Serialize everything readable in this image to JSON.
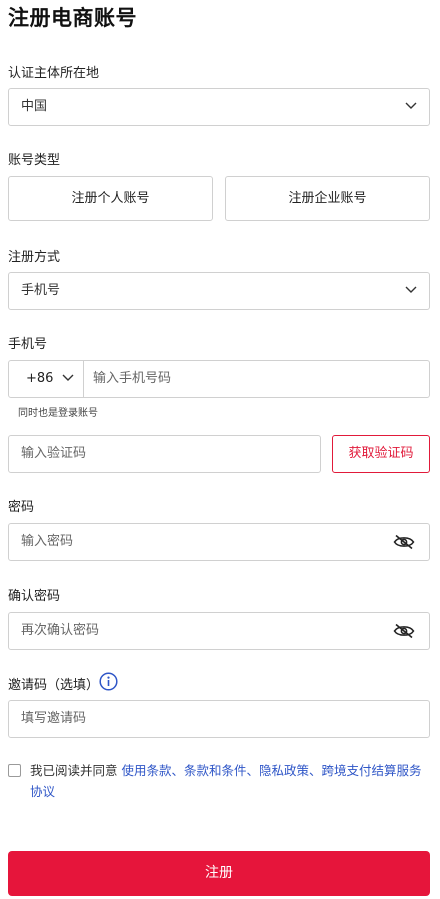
{
  "page_title": "注册电商账号",
  "region": {
    "label": "认证主体所在地",
    "value": "中国"
  },
  "account_type": {
    "label": "账号类型",
    "options": [
      "注册个人账号",
      "注册企业账号"
    ]
  },
  "method": {
    "label": "注册方式",
    "value": "手机号"
  },
  "phone": {
    "label": "手机号",
    "country_code": "+86",
    "placeholder": "输入手机号码",
    "hint": "同时也是登录账号"
  },
  "verification": {
    "placeholder": "输入验证码",
    "button": "获取验证码"
  },
  "password": {
    "label": "密码",
    "placeholder": "输入密码"
  },
  "confirm_password": {
    "label": "确认密码",
    "placeholder": "再次确认密码"
  },
  "invite": {
    "label": "邀请码（选填）",
    "placeholder": "填写邀请码"
  },
  "agreement": {
    "prefix": "我已阅读并同意 ",
    "links": "使用条款、条款和条件、隐私政策、跨境支付结算服务协议"
  },
  "submit": "注册",
  "icons": {
    "dropdown": "chevron-down-icon",
    "visibility": "eye-off-icon",
    "info": "info-circle-icon"
  },
  "colors": {
    "brand": "#e6153b",
    "link": "#2f56c7",
    "border": "#d0d0d0"
  }
}
